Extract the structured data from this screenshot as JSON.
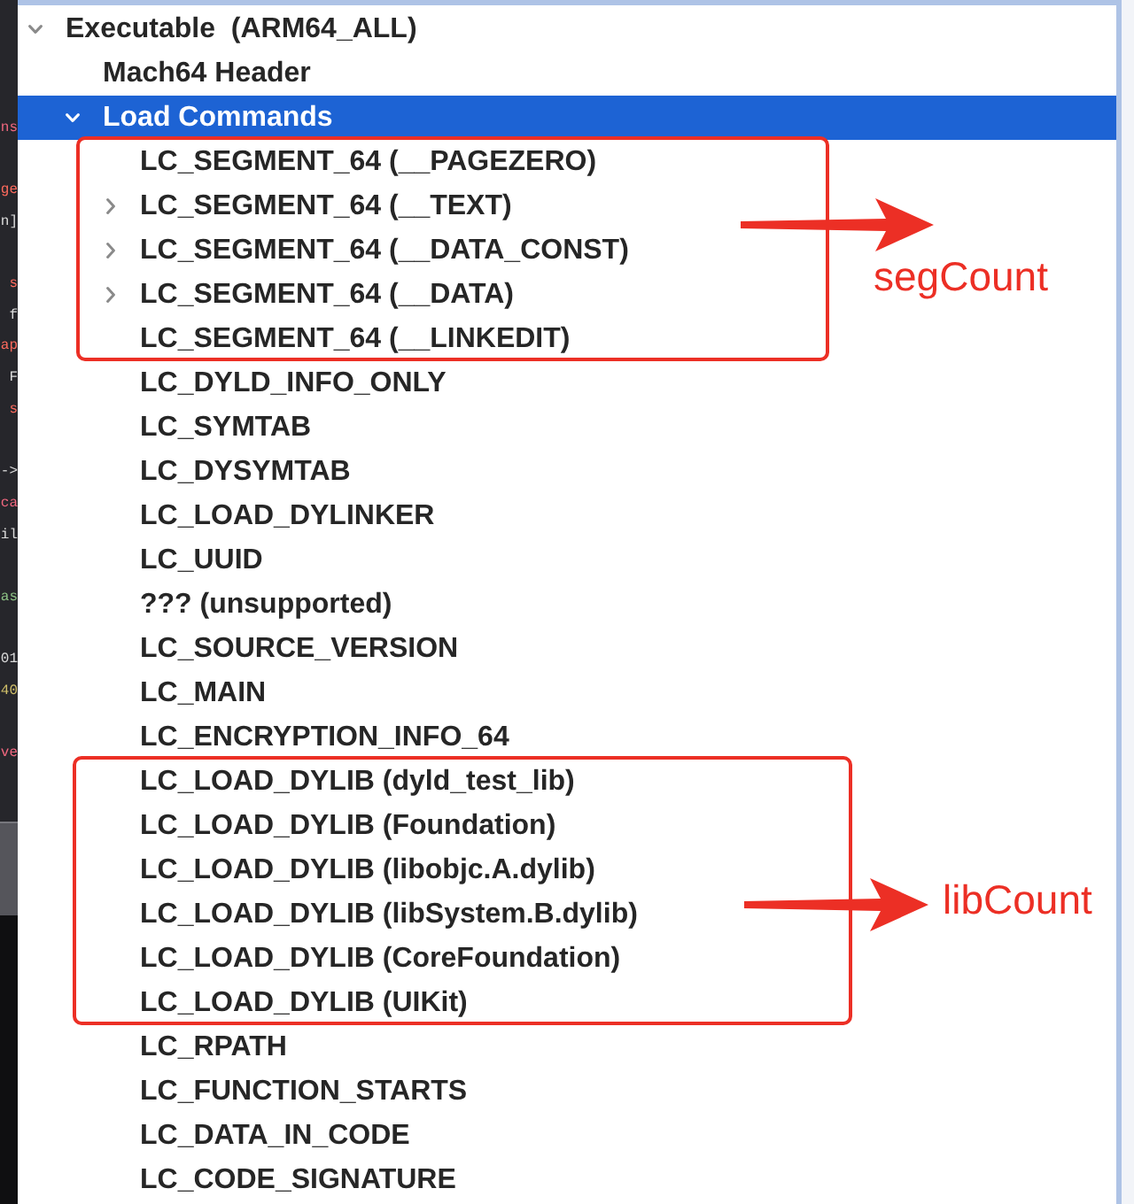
{
  "code_editor": {
    "fragments": [
      {
        "text": "ns",
        "color": "#f0677f"
      },
      {
        "text": "ge",
        "color": "#fc6a5d"
      },
      {
        "text": "n]",
        "color": "#dcdcdc"
      },
      {
        "text": "s",
        "color": "#fc6a5d"
      },
      {
        "text": "f",
        "color": "#dcdcdc"
      },
      {
        "text": "ap",
        "color": "#fc6a5d"
      },
      {
        "text": "F",
        "color": "#dcdcdc"
      },
      {
        "text": "s",
        "color": "#fc6a5d"
      },
      {
        "text": "->",
        "color": "#dcdcdc"
      },
      {
        "text": "ca",
        "color": "#f0677f"
      },
      {
        "text": "il",
        "color": "#dcdcdc"
      },
      {
        "text": "as",
        "color": "#8cc084"
      },
      {
        "text": "01",
        "color": "#dcdcdc"
      },
      {
        "text": "40",
        "color": "#d0bf69"
      },
      {
        "text": "ve",
        "color": "#f0677f"
      }
    ]
  },
  "tree": [
    {
      "label": "Executable  (ARM64_ALL)",
      "expanded": true,
      "selected": false,
      "children": [
        {
          "label": "Mach64 Header",
          "selected": false
        },
        {
          "label": "Load Commands",
          "expanded": true,
          "selected": true,
          "children": [
            {
              "label": "LC_SEGMENT_64 (__PAGEZERO)",
              "selected": false,
              "boxed": true
            },
            {
              "label": "LC_SEGMENT_64 (__TEXT)",
              "expanded": false,
              "selected": false,
              "boxed": true
            },
            {
              "label": "LC_SEGMENT_64 (__DATA_CONST)",
              "expanded": false,
              "selected": false,
              "boxed": true
            },
            {
              "label": "LC_SEGMENT_64 (__DATA)",
              "expanded": false,
              "selected": false,
              "boxed": true
            },
            {
              "label": "LC_SEGMENT_64 (__LINKEDIT)",
              "selected": false,
              "boxed": true
            },
            {
              "label": "LC_DYLD_INFO_ONLY",
              "selected": false,
              "boxed": false
            },
            {
              "label": "LC_SYMTAB",
              "selected": false,
              "boxed": false
            },
            {
              "label": "LC_DYSYMTAB",
              "selected": false,
              "boxed": false
            },
            {
              "label": "LC_LOAD_DYLINKER",
              "selected": false,
              "boxed": false
            },
            {
              "label": "LC_UUID",
              "selected": false,
              "boxed": false
            },
            {
              "label": "??? (unsupported)",
              "selected": false,
              "boxed": false
            },
            {
              "label": "LC_SOURCE_VERSION",
              "selected": false,
              "boxed": false
            },
            {
              "label": "LC_MAIN",
              "selected": false,
              "boxed": false
            },
            {
              "label": "LC_ENCRYPTION_INFO_64",
              "selected": false,
              "boxed": false
            },
            {
              "label": "LC_LOAD_DYLIB (dyld_test_lib)",
              "selected": false,
              "boxed": true
            },
            {
              "label": "LC_LOAD_DYLIB (Foundation)",
              "selected": false,
              "boxed": true
            },
            {
              "label": "LC_LOAD_DYLIB (libobjc.A.dylib)",
              "selected": false,
              "boxed": true
            },
            {
              "label": "LC_LOAD_DYLIB (libSystem.B.dylib)",
              "selected": false,
              "boxed": true
            },
            {
              "label": "LC_LOAD_DYLIB (CoreFoundation)",
              "selected": false,
              "boxed": true
            },
            {
              "label": "LC_LOAD_DYLIB (UIKit)",
              "selected": false,
              "boxed": true
            },
            {
              "label": "LC_RPATH",
              "selected": false,
              "boxed": false
            },
            {
              "label": "LC_FUNCTION_STARTS",
              "selected": false,
              "boxed": false
            },
            {
              "label": "LC_DATA_IN_CODE",
              "selected": false,
              "boxed": false
            },
            {
              "label": "LC_CODE_SIGNATURE",
              "selected": false,
              "boxed": false
            }
          ]
        }
      ]
    }
  ],
  "annotations": [
    {
      "label": "segCount"
    },
    {
      "label": "libCount"
    }
  ]
}
